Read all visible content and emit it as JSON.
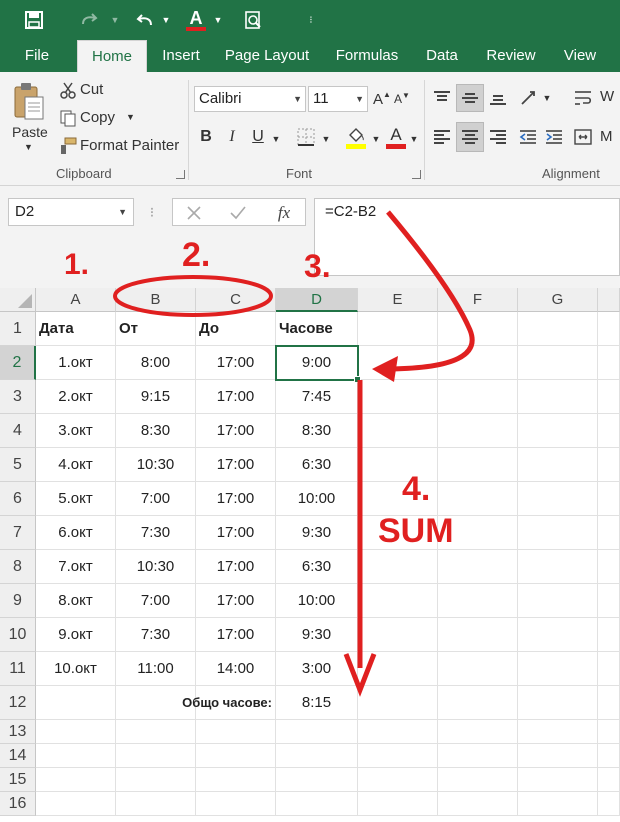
{
  "app": {
    "accent": "#217346",
    "annotation_color": "#e02020"
  },
  "tabs": [
    {
      "label": "File"
    },
    {
      "label": "Home",
      "active": true
    },
    {
      "label": "Insert"
    },
    {
      "label": "Page Layout"
    },
    {
      "label": "Formulas"
    },
    {
      "label": "Data"
    },
    {
      "label": "Review"
    },
    {
      "label": "View"
    }
  ],
  "ribbon": {
    "clipboard": {
      "paste_label": "Paste",
      "cut_label": "Cut",
      "copy_label": "Copy",
      "format_painter_label": "Format Painter",
      "group_label": "Clipboard"
    },
    "font": {
      "font_name": "Calibri",
      "font_size": "11",
      "bold_label": "B",
      "italic_label": "I",
      "underline_label": "U",
      "font_color_label": "A",
      "group_label": "Font"
    },
    "alignment": {
      "group_label": "Alignment",
      "wrap_label": "W",
      "merge_label": "M"
    }
  },
  "formula_bar": {
    "name_box": "D2",
    "fx_label": "fx",
    "formula": "=C2-B2"
  },
  "columns": [
    "A",
    "B",
    "C",
    "D",
    "E",
    "F",
    "G"
  ],
  "rows": [
    "1",
    "2",
    "3",
    "4",
    "5",
    "6",
    "7",
    "8",
    "9",
    "10",
    "11",
    "12",
    "13",
    "14",
    "15",
    "16"
  ],
  "sheet": {
    "headers": {
      "a": "Дата",
      "b": "От",
      "c": "До",
      "d": "Часове"
    },
    "data": [
      {
        "a": "1.окт",
        "b": "8:00",
        "c": "17:00",
        "d": "9:00"
      },
      {
        "a": "2.окт",
        "b": "9:15",
        "c": "17:00",
        "d": "7:45"
      },
      {
        "a": "3.окт",
        "b": "8:30",
        "c": "17:00",
        "d": "8:30"
      },
      {
        "a": "4.окт",
        "b": "10:30",
        "c": "17:00",
        "d": "6:30"
      },
      {
        "a": "5.окт",
        "b": "7:00",
        "c": "17:00",
        "d": "10:00"
      },
      {
        "a": "6.окт",
        "b": "7:30",
        "c": "17:00",
        "d": "9:30"
      },
      {
        "a": "7.окт",
        "b": "10:30",
        "c": "17:00",
        "d": "6:30"
      },
      {
        "a": "8.окт",
        "b": "7:00",
        "c": "17:00",
        "d": "10:00"
      },
      {
        "a": "9.окт",
        "b": "7:30",
        "c": "17:00",
        "d": "9:30"
      },
      {
        "a": "10.окт",
        "b": "11:00",
        "c": "14:00",
        "d": "3:00"
      }
    ],
    "total_label": "Общо часове:",
    "total_value": "8:15"
  },
  "annotations": {
    "n1": "1.",
    "n2": "2.",
    "n3": "3.",
    "n4": "4.",
    "sum": "SUM"
  }
}
